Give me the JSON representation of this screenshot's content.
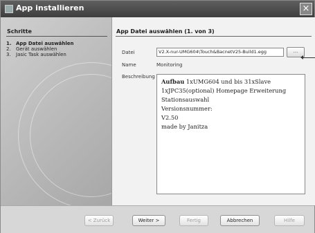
{
  "window": {
    "title": "App installieren",
    "close_label": "×"
  },
  "sidebar": {
    "title": "Schritte",
    "steps": [
      {
        "num": "1.",
        "label": "App Datei auswählen"
      },
      {
        "num": "2.",
        "label": "Gerät auswählen"
      },
      {
        "num": "3.",
        "label": "Jasic Task auswählen"
      }
    ]
  },
  "main": {
    "title": "App Datei auswählen (1. von 3)",
    "datei_label": "Datei",
    "datei_value": "V2.X-nur-UMG604\\Touch&BacnetV25-Build1.egg",
    "browse_label": "...",
    "name_label": "Name",
    "name_value": "Monitoring",
    "beschreibung_label": "Beschreibung",
    "description": {
      "line1_bold": "Aufbau",
      "line1_rest": " 1xUMG604 und bis 31xSlave",
      "line2": "1xJPC35(optional) Homepage Erweiterung",
      "line3": "Stationsauswahl",
      "line4": "Versionsnummer:",
      "line5": "V2.50",
      "line6": "made by Janitza"
    }
  },
  "footer": {
    "back_label": "< Zurück",
    "next_label": "Weiter >",
    "finish_label": "Fertig",
    "cancel_label": "Abbrechen",
    "help_label": "Hilfe"
  }
}
